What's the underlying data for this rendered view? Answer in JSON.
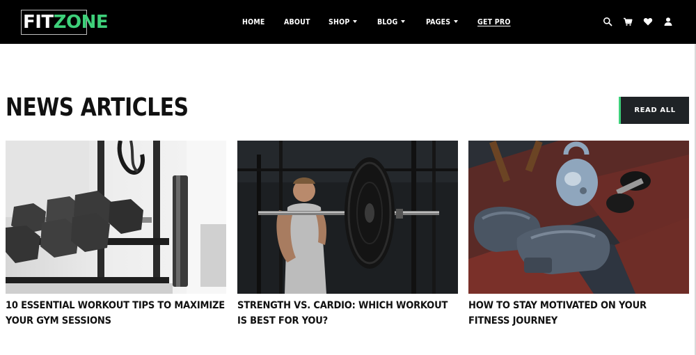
{
  "header": {
    "logo": {
      "part1": "FIT",
      "part2": "ZONE"
    },
    "nav": [
      {
        "label": "HOME",
        "has_dropdown": false
      },
      {
        "label": "ABOUT",
        "has_dropdown": false
      },
      {
        "label": "SHOP",
        "has_dropdown": true
      },
      {
        "label": "BLOG",
        "has_dropdown": true
      },
      {
        "label": "PAGES",
        "has_dropdown": true
      },
      {
        "label": "GET PRO",
        "has_dropdown": false
      }
    ],
    "icons": [
      "search-icon",
      "cart-icon",
      "heart-icon",
      "user-icon"
    ]
  },
  "section": {
    "title": "NEWS ARTICLES",
    "button_label": "READ ALL"
  },
  "articles": [
    {
      "title": "10 ESSENTIAL WORKOUT TIPS TO MAXIMIZE YOUR GYM SESSIONS",
      "image": "dumbbell-rack-photo"
    },
    {
      "title": "STRENGTH VS. CARDIO: WHICH WORKOUT IS BEST FOR YOU?",
      "image": "barbell-lifter-photo"
    },
    {
      "title": "HOW TO STAY MOTIVATED ON YOUR FITNESS JOURNEY",
      "image": "boxing-gloves-kettlebell-photo"
    }
  ],
  "colors": {
    "accent": "#3ed07a",
    "header_bg": "#000000",
    "button_bg": "#1f2326",
    "text": "#111111"
  }
}
